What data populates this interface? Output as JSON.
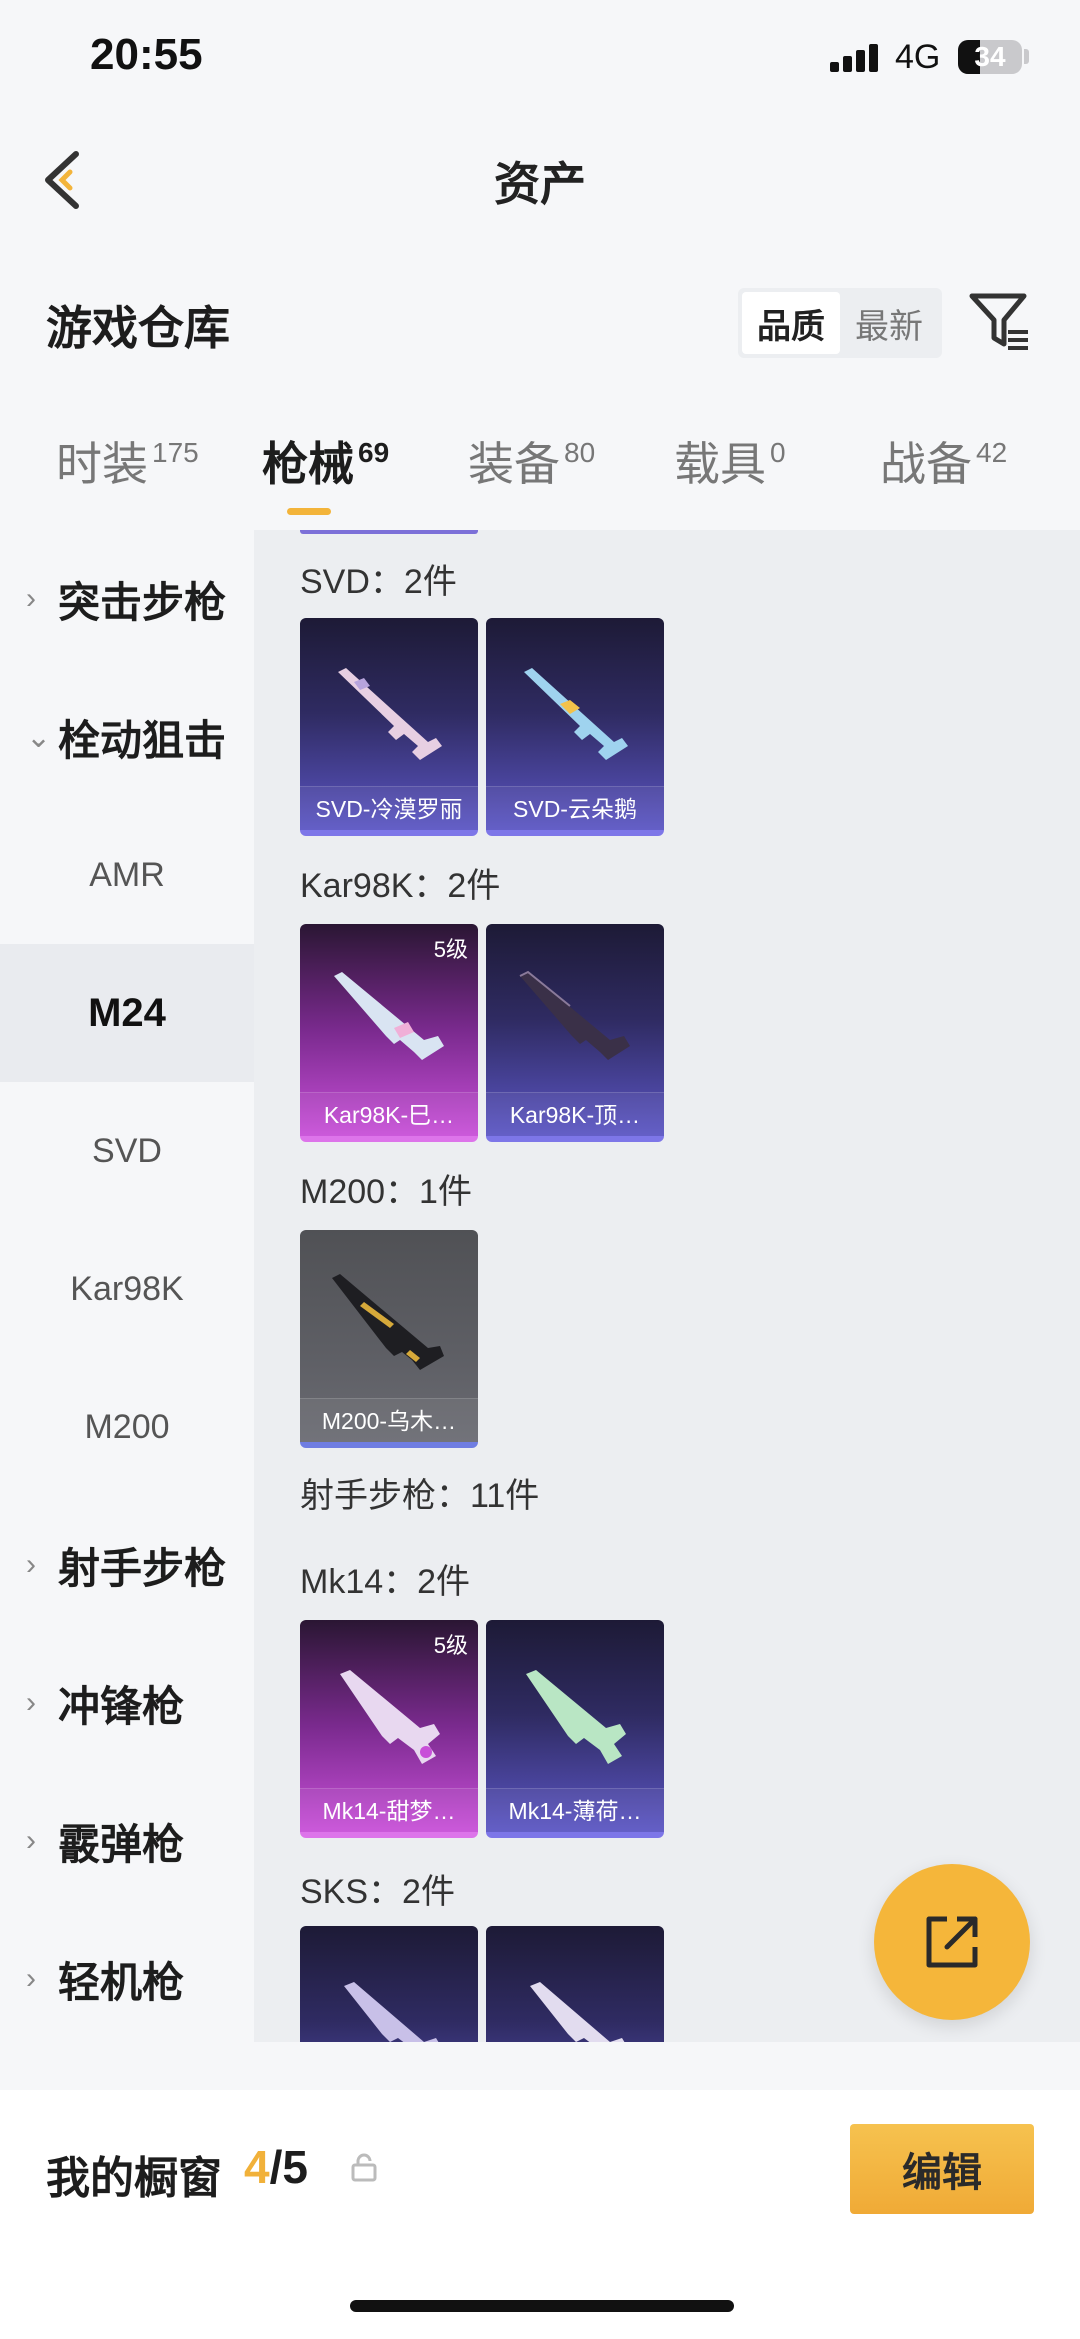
{
  "status": {
    "time": "20:55",
    "network": "4G",
    "battery": "34"
  },
  "header": {
    "title": "资产"
  },
  "warehouse": {
    "title": "游戏仓库",
    "sort_options": [
      "品质",
      "最新"
    ]
  },
  "tabs": [
    {
      "label": "时装",
      "count": "175"
    },
    {
      "label": "枪械",
      "count": "69",
      "active": true
    },
    {
      "label": "装备",
      "count": "80"
    },
    {
      "label": "载具",
      "count": "0"
    },
    {
      "label": "战备",
      "count": "42"
    }
  ],
  "sidebar": [
    {
      "label": "突击步枪",
      "type": "group"
    },
    {
      "label": "栓动狙击",
      "type": "group",
      "expanded": true
    },
    {
      "label": "AMR",
      "type": "sub"
    },
    {
      "label": "M24",
      "type": "sub",
      "active": true
    },
    {
      "label": "SVD",
      "type": "sub"
    },
    {
      "label": "Kar98K",
      "type": "sub"
    },
    {
      "label": "M200",
      "type": "sub"
    },
    {
      "label": "射手步枪",
      "type": "group"
    },
    {
      "label": "冲锋枪",
      "type": "group"
    },
    {
      "label": "霰弹枪",
      "type": "group"
    },
    {
      "label": "轻机枪",
      "type": "group"
    }
  ],
  "content": {
    "groups": [
      {
        "label": "SVD：2件",
        "cards": [
          {
            "name": "SVD-冷漠罗丽",
            "rarity": "purple",
            "tier": ""
          },
          {
            "name": "SVD-云朵鹅",
            "rarity": "purple",
            "tier": ""
          }
        ]
      },
      {
        "label": "Kar98K：2件",
        "cards": [
          {
            "name": "Kar98K-巳…",
            "rarity": "pink",
            "tier": "5级"
          },
          {
            "name": "Kar98K-顶…",
            "rarity": "purple",
            "tier": ""
          }
        ]
      },
      {
        "label": "M200：1件",
        "cards": [
          {
            "name": "M200-乌木…",
            "rarity": "gray",
            "tier": ""
          }
        ]
      },
      {
        "label": "射手步枪：11件",
        "cards": []
      },
      {
        "label": "Mk14：2件",
        "cards": [
          {
            "name": "Mk14-甜梦…",
            "rarity": "pink",
            "tier": "5级"
          },
          {
            "name": "Mk14-薄荷…",
            "rarity": "purple",
            "tier": ""
          }
        ]
      },
      {
        "label": "SKS：2件",
        "cards": [
          {
            "name": "",
            "rarity": "purple",
            "tier": ""
          },
          {
            "name": "",
            "rarity": "purple",
            "tier": ""
          }
        ]
      }
    ]
  },
  "showcase": {
    "label": "我的橱窗",
    "current": "4",
    "total": "/5",
    "edit_label": "编辑"
  },
  "colors": {
    "accent": "#f3b43a",
    "purple_card": "#5b55c4",
    "pink_card": "#c84fd8"
  },
  "icons": {
    "back": "chevron-left-icon",
    "filter": "filter-icon",
    "share": "external-link-icon",
    "lock": "lock-icon"
  }
}
